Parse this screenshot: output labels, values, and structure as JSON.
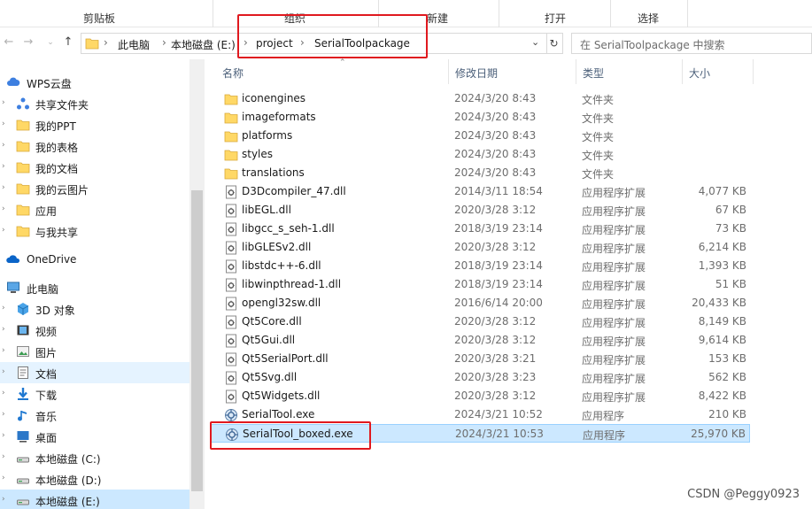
{
  "ribbon": {
    "groups": [
      "剪贴板",
      "组织",
      "新建",
      "打开",
      "选择"
    ]
  },
  "address": {
    "path": [
      "此电脑",
      "本地磁盘 (E:)",
      "project",
      "SerialToolpackage"
    ],
    "search_placeholder": "在 SerialToolpackage 中搜索"
  },
  "nav": {
    "items": [
      {
        "label": "WPS云盘",
        "icon": "wps-cloud-icon"
      },
      {
        "label": "共享文件夹",
        "icon": "share-icon"
      },
      {
        "label": "我的PPT",
        "icon": "folder-icon"
      },
      {
        "label": "我的表格",
        "icon": "folder-icon"
      },
      {
        "label": "我的文档",
        "icon": "folder-icon"
      },
      {
        "label": "我的云图片",
        "icon": "folder-icon"
      },
      {
        "label": "应用",
        "icon": "folder-icon"
      },
      {
        "label": "与我共享",
        "icon": "folder-icon"
      },
      {
        "label": "OneDrive",
        "icon": "onedrive-icon"
      },
      {
        "label": "此电脑",
        "icon": "computer-icon"
      },
      {
        "label": "3D 对象",
        "icon": "3d-objects-icon"
      },
      {
        "label": "视频",
        "icon": "video-icon"
      },
      {
        "label": "图片",
        "icon": "pictures-icon"
      },
      {
        "label": "文档",
        "icon": "documents-icon"
      },
      {
        "label": "下载",
        "icon": "download-icon"
      },
      {
        "label": "音乐",
        "icon": "music-icon"
      },
      {
        "label": "桌面",
        "icon": "desktop-icon"
      },
      {
        "label": "本地磁盘 (C:)",
        "icon": "drive-icon"
      },
      {
        "label": "本地磁盘 (D:)",
        "icon": "drive-icon"
      },
      {
        "label": "本地磁盘 (E:)",
        "icon": "drive-icon"
      }
    ]
  },
  "columns": {
    "name": "名称",
    "date": "修改日期",
    "type": "类型",
    "size": "大小"
  },
  "files": [
    {
      "name": "iconengines",
      "date": "2024/3/20 8:43",
      "type": "文件夹",
      "size": "",
      "kind": "folder"
    },
    {
      "name": "imageformats",
      "date": "2024/3/20 8:43",
      "type": "文件夹",
      "size": "",
      "kind": "folder"
    },
    {
      "name": "platforms",
      "date": "2024/3/20 8:43",
      "type": "文件夹",
      "size": "",
      "kind": "folder"
    },
    {
      "name": "styles",
      "date": "2024/3/20 8:43",
      "type": "文件夹",
      "size": "",
      "kind": "folder"
    },
    {
      "name": "translations",
      "date": "2024/3/20 8:43",
      "type": "文件夹",
      "size": "",
      "kind": "folder"
    },
    {
      "name": "D3Dcompiler_47.dll",
      "date": "2014/3/11 18:54",
      "type": "应用程序扩展",
      "size": "4,077 KB",
      "kind": "dll"
    },
    {
      "name": "libEGL.dll",
      "date": "2020/3/28 3:12",
      "type": "应用程序扩展",
      "size": "67 KB",
      "kind": "dll"
    },
    {
      "name": "libgcc_s_seh-1.dll",
      "date": "2018/3/19 23:14",
      "type": "应用程序扩展",
      "size": "73 KB",
      "kind": "dll"
    },
    {
      "name": "libGLESv2.dll",
      "date": "2020/3/28 3:12",
      "type": "应用程序扩展",
      "size": "6,214 KB",
      "kind": "dll"
    },
    {
      "name": "libstdc++-6.dll",
      "date": "2018/3/19 23:14",
      "type": "应用程序扩展",
      "size": "1,393 KB",
      "kind": "dll"
    },
    {
      "name": "libwinpthread-1.dll",
      "date": "2018/3/19 23:14",
      "type": "应用程序扩展",
      "size": "51 KB",
      "kind": "dll"
    },
    {
      "name": "opengl32sw.dll",
      "date": "2016/6/14 20:00",
      "type": "应用程序扩展",
      "size": "20,433 KB",
      "kind": "dll"
    },
    {
      "name": "Qt5Core.dll",
      "date": "2020/3/28 3:12",
      "type": "应用程序扩展",
      "size": "8,149 KB",
      "kind": "dll"
    },
    {
      "name": "Qt5Gui.dll",
      "date": "2020/3/28 3:12",
      "type": "应用程序扩展",
      "size": "9,614 KB",
      "kind": "dll"
    },
    {
      "name": "Qt5SerialPort.dll",
      "date": "2020/3/28 3:21",
      "type": "应用程序扩展",
      "size": "153 KB",
      "kind": "dll"
    },
    {
      "name": "Qt5Svg.dll",
      "date": "2020/3/28 3:23",
      "type": "应用程序扩展",
      "size": "562 KB",
      "kind": "dll"
    },
    {
      "name": "Qt5Widgets.dll",
      "date": "2020/3/28 3:12",
      "type": "应用程序扩展",
      "size": "8,422 KB",
      "kind": "dll"
    },
    {
      "name": "SerialTool.exe",
      "date": "2024/3/21 10:52",
      "type": "应用程序",
      "size": "210 KB",
      "kind": "exe"
    },
    {
      "name": "SerialTool_boxed.exe",
      "date": "2024/3/21 10:53",
      "type": "应用程序",
      "size": "25,970 KB",
      "kind": "exe",
      "selected": true
    }
  ],
  "watermark": "CSDN @Peggy0923",
  "colors": {
    "highlight": "#e0191f",
    "selection": "#cce8ff",
    "folder": "#ffd866"
  }
}
